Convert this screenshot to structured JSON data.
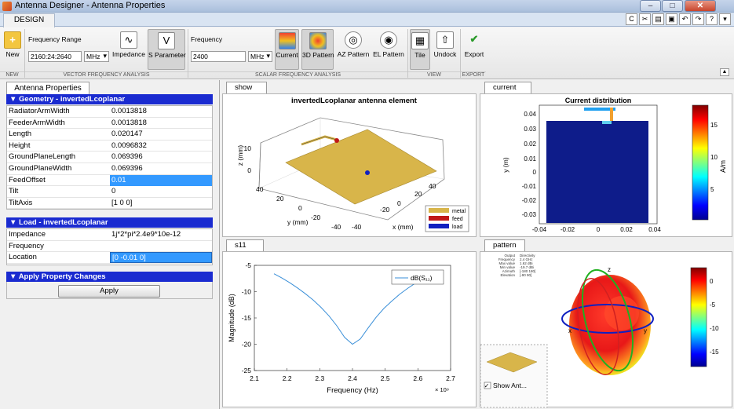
{
  "window": {
    "title": "Antenna Designer - Antenna Properties",
    "close": "✕",
    "minimize": "–",
    "maximize": "□"
  },
  "tabs": {
    "design": "DESIGN"
  },
  "toolstrip": {
    "new_label": "New",
    "freq_range_label": "Frequency Range",
    "freq_range_value": "2160:24:2640",
    "freq_range_units": "MHz",
    "impedance_label": "Impedance",
    "sparam_label": "S Parameter",
    "frequency_label": "Frequency",
    "frequency_value": "2400",
    "frequency_units": "MHz",
    "current_label": "Current",
    "pattern3d_label": "3D Pattern",
    "az_label": "AZ Pattern",
    "el_label": "EL Pattern",
    "tile_label": "Tile",
    "undock_label": "Undock",
    "export_label": "Export",
    "sections": {
      "new": "NEW",
      "vector": "VECTOR FREQUENCY ANALYSIS",
      "scalar": "SCALAR FREQUENCY ANALYSIS",
      "view": "VIEW",
      "export": "EXPORT"
    }
  },
  "left_panel": {
    "tab": "Antenna Properties",
    "geometry_header": "▼ Geometry - invertedLcoplanar",
    "geometry": [
      {
        "name": "RadiatorArmWidth",
        "value": "0.0013818"
      },
      {
        "name": "FeederArmWidth",
        "value": "0.0013818"
      },
      {
        "name": "Length",
        "value": "0.020147"
      },
      {
        "name": "Height",
        "value": "0.0096832"
      },
      {
        "name": "GroundPlaneLength",
        "value": "0.069396"
      },
      {
        "name": "GroundPlaneWidth",
        "value": "0.069396"
      },
      {
        "name": "FeedOffset",
        "value": "0.01"
      },
      {
        "name": "Tilt",
        "value": "0"
      },
      {
        "name": "TiltAxis",
        "value": "[1 0 0]"
      }
    ],
    "load_header": "▼ Load - invertedLcoplanar",
    "load": [
      {
        "name": "Impedance",
        "value": "1j*2*pi*2.4e9*10e-12"
      },
      {
        "name": "Frequency",
        "value": ""
      },
      {
        "name": "Location",
        "value": "[0 -0.01 0]"
      }
    ],
    "apply_header": "▼ Apply Property Changes",
    "apply_button": "Apply"
  },
  "show_panel": {
    "tab": "show",
    "title": "invertedLcoplanar antenna element",
    "zlabel": "z (mm)",
    "ylabel": "y (mm)",
    "xlabel": "x (mm)",
    "z_ticks": [
      "10",
      "0"
    ],
    "y_ticks": [
      "40",
      "20",
      "0",
      "-20",
      "-40"
    ],
    "x_ticks": [
      "-40",
      "-20",
      "0",
      "20",
      "40"
    ],
    "legend": [
      {
        "label": "metal",
        "color": "#d8b54a"
      },
      {
        "label": "feed",
        "color": "#c01818"
      },
      {
        "label": "load",
        "color": "#1020c0"
      }
    ]
  },
  "current_panel": {
    "tab": "current",
    "title": "Current distribution",
    "ylabel": "y (m)",
    "x_ticks": [
      "-0.04",
      "-0.02",
      "0",
      "0.02",
      "0.04"
    ],
    "y_ticks": [
      "0.04",
      "0.03",
      "0.02",
      "0.01",
      "0",
      "-0.01",
      "-0.02",
      "-0.03"
    ],
    "colorbar_ticks": [
      "15",
      "10",
      "5"
    ],
    "colorbar_unit": "A/m"
  },
  "s11_panel": {
    "tab": "s11",
    "xlabel": "Frequency (Hz)",
    "ylabel": "Magnitude (dB)",
    "exponent": "× 10⁹",
    "legend_label": "dB(S₁₁)"
  },
  "pattern_panel": {
    "tab": "pattern",
    "info_keys": [
      "Output",
      "Frequency",
      "Max value",
      "Min value",
      "Azimuth",
      "Elevation"
    ],
    "info_values": [
      "Directivity",
      "2.4 GHz",
      "1.62 dBi",
      "-19.7 dBi",
      "[-180 180]",
      "[-90 90]"
    ],
    "colorbar_ticks": [
      "0",
      "-5",
      "-10",
      "-15"
    ],
    "axis_labels": {
      "x": "x",
      "y": "y",
      "z": "z"
    },
    "show_antenna_label": "Show Ant..."
  },
  "chart_data": {
    "type": "line",
    "xlabel": "Frequency (Hz)",
    "ylabel": "Magnitude (dB)",
    "x_scale_note": "× 10⁹",
    "xlim": [
      2.1,
      2.7
    ],
    "ylim": [
      -25,
      -5
    ],
    "x_ticks": [
      2.1,
      2.2,
      2.3,
      2.4,
      2.5,
      2.6,
      2.7
    ],
    "y_ticks": [
      -5,
      -10,
      -15,
      -20,
      -25
    ],
    "series": [
      {
        "name": "dB(S11)",
        "color": "#3a8fd8",
        "x": [
          2.16,
          2.184,
          2.208,
          2.232,
          2.256,
          2.28,
          2.304,
          2.328,
          2.352,
          2.376,
          2.4,
          2.424,
          2.448,
          2.472,
          2.496,
          2.52,
          2.544,
          2.568,
          2.592,
          2.616,
          2.64
        ],
        "y": [
          -6.6,
          -7.4,
          -8.3,
          -9.3,
          -10.4,
          -11.6,
          -13.0,
          -14.6,
          -16.5,
          -18.7,
          -20.0,
          -19.0,
          -16.9,
          -14.9,
          -13.2,
          -11.8,
          -10.5,
          -9.4,
          -8.4,
          -7.5,
          -6.8
        ]
      }
    ]
  }
}
